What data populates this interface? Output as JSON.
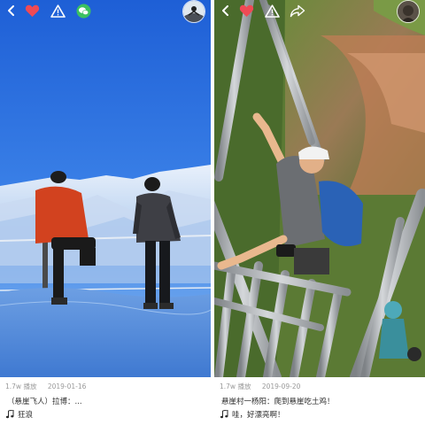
{
  "cards": [
    {
      "views": "1.7w 播放",
      "date": "2019-01-16",
      "title": "（悬崖飞人）拉博：...",
      "music": "狂浪",
      "icons": [
        "back-icon",
        "heart-icon",
        "warning-icon",
        "wechat-icon",
        "avatar"
      ]
    },
    {
      "views": "1.7w 播放",
      "date": "2019-09-20",
      "title": "悬崖村一杨阳：爬到悬崖吃土鸡！",
      "music": "哇，好漂亮啊！",
      "icons": [
        "back-icon",
        "heart-icon",
        "warning-icon",
        "share-icon",
        "avatar"
      ]
    }
  ],
  "colors": {
    "heart": "#f04a55",
    "wechat": "#3cc160",
    "meta_gray": "#9a9a9a",
    "text": "#2a2a2a"
  }
}
